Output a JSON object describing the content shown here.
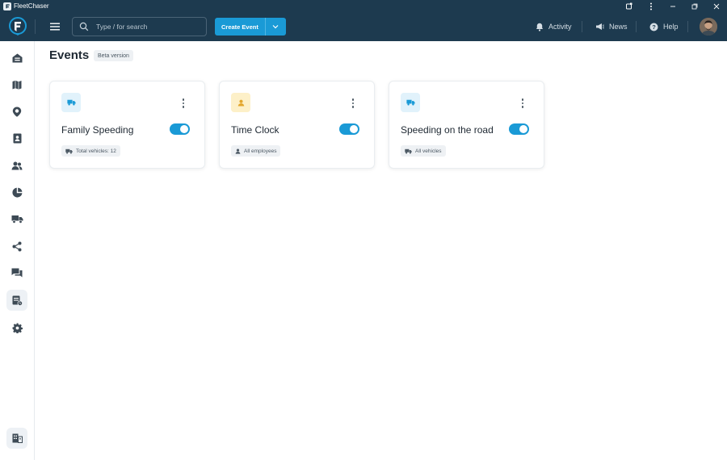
{
  "window": {
    "title": "FleetChaser"
  },
  "header": {
    "search_placeholder": "Type / for search",
    "create_button_label": "Create Event",
    "links": {
      "activity": "Activity",
      "news": "News",
      "help": "Help"
    }
  },
  "sidebar": {
    "items": [
      {
        "icon": "home-icon"
      },
      {
        "icon": "map-icon"
      },
      {
        "icon": "location-pin-icon"
      },
      {
        "icon": "contacts-book-icon"
      },
      {
        "icon": "users-icon"
      },
      {
        "icon": "pie-chart-icon"
      },
      {
        "icon": "truck-icon"
      },
      {
        "icon": "share-icon"
      },
      {
        "icon": "chat-icon"
      },
      {
        "icon": "events-icon",
        "active": true
      },
      {
        "icon": "settings-gear-icon"
      }
    ],
    "bottom_item": {
      "icon": "building-icon"
    }
  },
  "page": {
    "title": "Events",
    "badge": "Beta version"
  },
  "colors": {
    "accent": "#1a9ad6",
    "header_bg": "#1d3a4f",
    "vehicle_icon_bg": "#e1f2fb",
    "employee_icon_bg": "#fdf0c8"
  },
  "cards": [
    {
      "title": "Family Speeding",
      "tag": "Total vehicles: 12",
      "icon": "truck-icon",
      "tag_icon": "truck-icon",
      "enabled": true
    },
    {
      "title": "Time Clock",
      "tag": "All employees",
      "icon": "person-icon",
      "tag_icon": "person-icon",
      "enabled": true
    },
    {
      "title": "Speeding on the road",
      "tag": "All vehicles",
      "icon": "truck-icon",
      "tag_icon": "truck-icon",
      "enabled": true
    }
  ]
}
